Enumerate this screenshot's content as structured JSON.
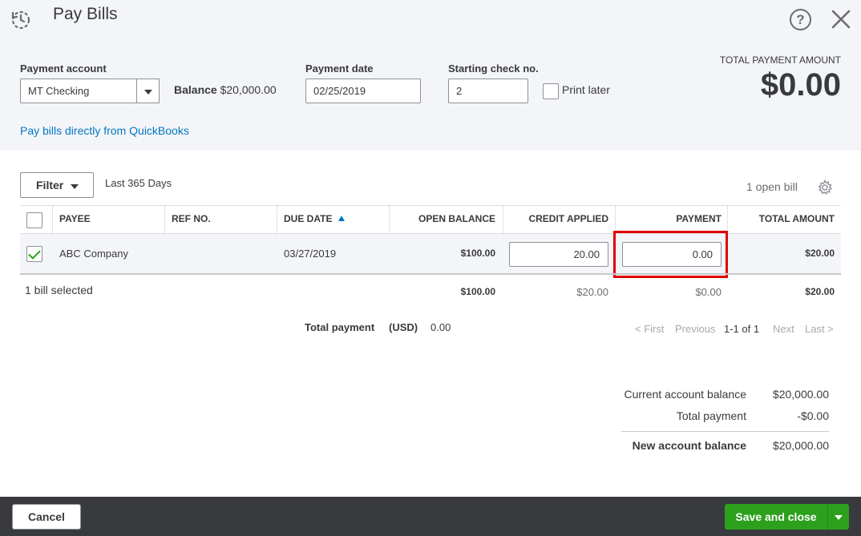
{
  "header": {
    "title": "Pay Bills",
    "help_glyph": "?",
    "icons": [
      "recent-transactions-icon",
      "help-icon",
      "close-icon"
    ]
  },
  "payment": {
    "account_label": "Payment account",
    "account_value": "MT Checking",
    "balance_label": "Balance",
    "balance_value": "$20,000.00",
    "date_label": "Payment date",
    "date_value": "02/25/2019",
    "check_label": "Starting check no.",
    "check_value": "2",
    "print_later_label": "Print later",
    "print_later_checked": false,
    "total_label": "TOTAL PAYMENT AMOUNT",
    "total_value": "$0.00",
    "link_text": "Pay bills directly from QuickBooks"
  },
  "filter": {
    "button_label": "Filter",
    "range_text": "Last 365 Days",
    "open_bills": "1 open bill"
  },
  "table": {
    "headers": {
      "payee": "PAYEE",
      "ref": "REF NO.",
      "due": "DUE DATE",
      "open": "OPEN BALANCE",
      "credit": "CREDIT APPLIED",
      "payment": "PAYMENT",
      "total": "TOTAL AMOUNT"
    },
    "rows": [
      {
        "selected": true,
        "payee": "ABC Company",
        "ref": "",
        "due": "03/27/2019",
        "open": "$100.00",
        "credit": "20.00",
        "payment": "0.00",
        "total": "$20.00"
      }
    ],
    "summary": {
      "selected_text": "1 bill selected",
      "open": "$100.00",
      "credit": "$20.00",
      "payment": "$0.00",
      "total": "$20.00"
    }
  },
  "total_payment": {
    "label": "Total payment",
    "currency": "(USD)",
    "value": "0.00"
  },
  "pager": {
    "first": "< First",
    "previous": "Previous",
    "range": "1-1 of 1",
    "next": "Next",
    "last": "Last >"
  },
  "balances": {
    "current_label": "Current account balance",
    "current_value": "$20,000.00",
    "payment_label": "Total payment",
    "payment_value": "-$0.00",
    "new_label": "New account balance",
    "new_value": "$20,000.00"
  },
  "footer": {
    "cancel_label": "Cancel",
    "save_label": "Save and close"
  },
  "colors": {
    "accent_green": "#2ca01c",
    "link_blue": "#0077c5",
    "highlight_red": "#e00000",
    "footer_bg": "#393a3d"
  }
}
